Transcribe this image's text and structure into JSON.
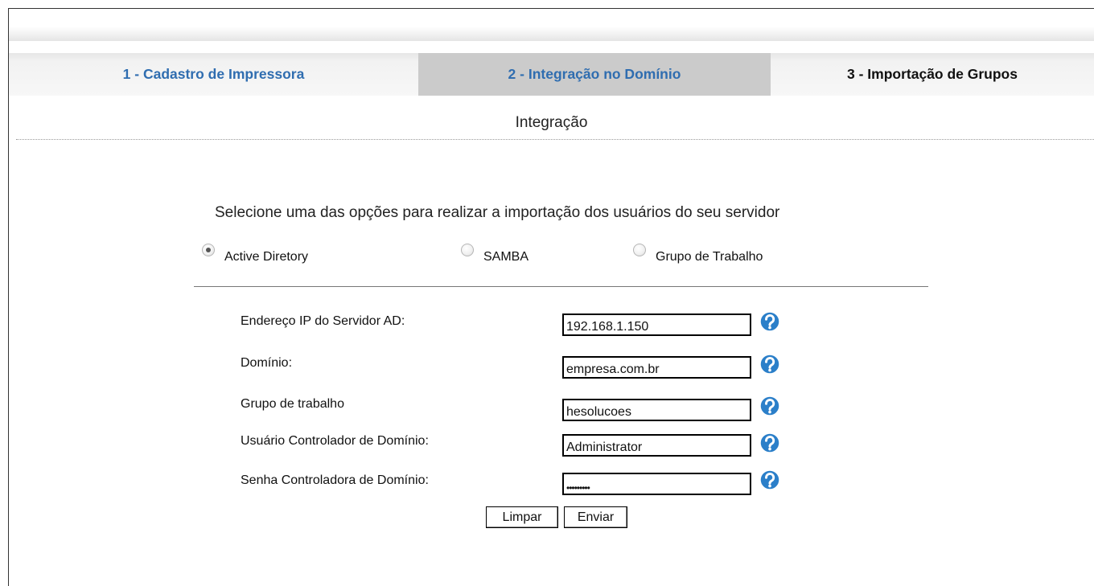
{
  "tabs": [
    {
      "label": "1 - Cadastro de Impressora"
    },
    {
      "label": "2 - Integração no Domínio"
    },
    {
      "label": "3 - Importação de Grupos"
    }
  ],
  "section_title": "Integração",
  "instruction": "Selecione uma das opções para realizar a importação dos usuários do seu servidor",
  "radios": [
    {
      "label": "Active Diretory",
      "checked": true
    },
    {
      "label": "SAMBA",
      "checked": false
    },
    {
      "label": "Grupo de Trabalho",
      "checked": false
    }
  ],
  "fields": [
    {
      "label": "Endereço IP do Servidor AD:",
      "value": "192.168.1.150"
    },
    {
      "label": "Domínio:",
      "value": "empresa.com.br"
    },
    {
      "label": "Grupo de trabalho",
      "value": "hesolucoes"
    },
    {
      "label": "Usuário Controlador de Domínio:",
      "value": "Administrator"
    },
    {
      "label": "Senha Controladora de Domínio:",
      "value": "•••••••••"
    }
  ],
  "buttons": {
    "clear": "Limpar",
    "send": "Enviar"
  },
  "colors": {
    "tab_link": "#2f6db0",
    "active_tab_bg": "#cbcbcb",
    "help_icon": "#2b7fc9"
  },
  "icons": {
    "help": "help-question-icon"
  }
}
